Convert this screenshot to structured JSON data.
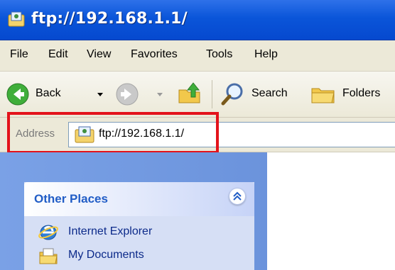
{
  "window": {
    "title": "ftp://192.168.1.1/"
  },
  "menubar": {
    "items": [
      "File",
      "Edit",
      "View",
      "Favorites",
      "Tools",
      "Help"
    ]
  },
  "toolbar": {
    "back_label": "Back",
    "search_label": "Search",
    "folders_label": "Folders"
  },
  "address": {
    "label": "Address",
    "value": "ftp://192.168.1.1/"
  },
  "taskpane": {
    "other_places": {
      "title": "Other Places",
      "items": [
        {
          "label": "Internet Explorer"
        },
        {
          "label": "My Documents"
        }
      ]
    }
  },
  "colors": {
    "titlebar": "#0a55d9",
    "highlight": "#e3131b",
    "taskpane": "#7aa1e6",
    "link": "#0c2a8a"
  },
  "icons": [
    "ftp-folder-icon",
    "back-arrow-icon",
    "forward-arrow-icon",
    "up-folder-icon",
    "search-magnifier-icon",
    "folders-icon",
    "collapse-chevron-icon",
    "internet-explorer-icon",
    "my-documents-icon"
  ]
}
